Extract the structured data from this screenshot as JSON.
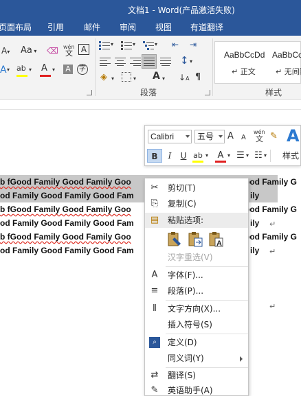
{
  "window": {
    "title": "文档1 - Word(产品激活失败)"
  },
  "tabs": [
    "页面布局",
    "引用",
    "邮件",
    "审阅",
    "视图",
    "有道翻译"
  ],
  "ribbon": {
    "font_grow": "A",
    "font_shrink": "A",
    "change_case": "Aa",
    "phonetic_top": "wén",
    "phonetic_base": "文",
    "char_border": "A",
    "text_effect": "A",
    "highlight": "ab",
    "font_color": "A",
    "char_shading": "A",
    "enclose_char": "字",
    "line_spacing": "↕",
    "char_scale": "A",
    "paragraph_label": "段落",
    "styles_label": "样式",
    "styles": [
      {
        "sample": "AaBbCcDd",
        "name": "↵ 正文"
      },
      {
        "sample": "AaBbCcDd",
        "name": "↵ 无间隔"
      }
    ],
    "colors": {
      "highlight": "#ffff00",
      "font_color": "#e02020",
      "accent": "#2b579a"
    }
  },
  "document": {
    "lines": [
      {
        "text": "b  fGood  Family  Good  Family  Goo",
        "tail": "ood  Family  G",
        "selected": true,
        "wavy": true
      },
      {
        "text": "od  Family   Good  Family  Good  Fam",
        "tail": "ily",
        "selected": true,
        "wavy": false
      },
      {
        "text": "b  fGood  Family  Good  Family  Goo",
        "tail": "ood  Family  G",
        "selected": false,
        "wavy": true
      },
      {
        "text": "od  Family   Good  Family  Good  Fam",
        "tail": "ily",
        "selected": false,
        "wavy": false
      },
      {
        "text": "b  fGood  Family  Good  Family  Goo",
        "tail": "ood  Family  G",
        "selected": false,
        "wavy": true
      },
      {
        "text": "od  Family   Good  Family  Good  Fam",
        "tail": "ily",
        "selected": false,
        "wavy": false
      }
    ],
    "return_mark": "↵"
  },
  "mini_toolbar": {
    "font_name": "Calibri",
    "font_size": "五号",
    "grow": "A",
    "shrink": "A",
    "phonetic_top": "wén",
    "phonetic_base": "文",
    "big_a": "A",
    "bold": "B",
    "italic": "I",
    "underline": "U",
    "highlight": "ab",
    "font_color": "A",
    "styles_label": "样式"
  },
  "context_menu": {
    "items": [
      {
        "label": "剪切(T)",
        "icon": "scissors-icon",
        "glyph": "✂",
        "disabled": false
      },
      {
        "label": "复制(C)",
        "icon": "copy-icon",
        "glyph": "⎘",
        "disabled": false
      },
      {
        "label": "粘贴选项:",
        "icon": "paste-icon",
        "glyph": "📋",
        "disabled": false
      },
      {
        "label": "汉字重选(V)",
        "icon": "",
        "glyph": "",
        "disabled": true
      },
      {
        "label": "字体(F)...",
        "icon": "font-icon",
        "glyph": "A",
        "disabled": false
      },
      {
        "label": "段落(P)...",
        "icon": "paragraph-icon",
        "glyph": "≡",
        "disabled": false
      },
      {
        "label": "文字方向(X)...",
        "icon": "text-direction-icon",
        "glyph": "⫴",
        "disabled": false
      },
      {
        "label": "插入符号(S)",
        "icon": "",
        "glyph": "",
        "disabled": false
      },
      {
        "label": "定义(D)",
        "icon": "define-icon",
        "glyph": "🔍",
        "disabled": false
      },
      {
        "label": "同义词(Y)",
        "icon": "",
        "glyph": "",
        "disabled": false
      },
      {
        "label": "翻译(S)",
        "icon": "translate-icon",
        "glyph": "⇄",
        "disabled": false
      },
      {
        "label": "英语助手(A)",
        "icon": "english-assistant-icon",
        "glyph": "✎",
        "disabled": false
      }
    ],
    "paste_options": [
      "keep-source-formatting-icon",
      "merge-formatting-icon",
      "keep-text-only-icon"
    ]
  }
}
